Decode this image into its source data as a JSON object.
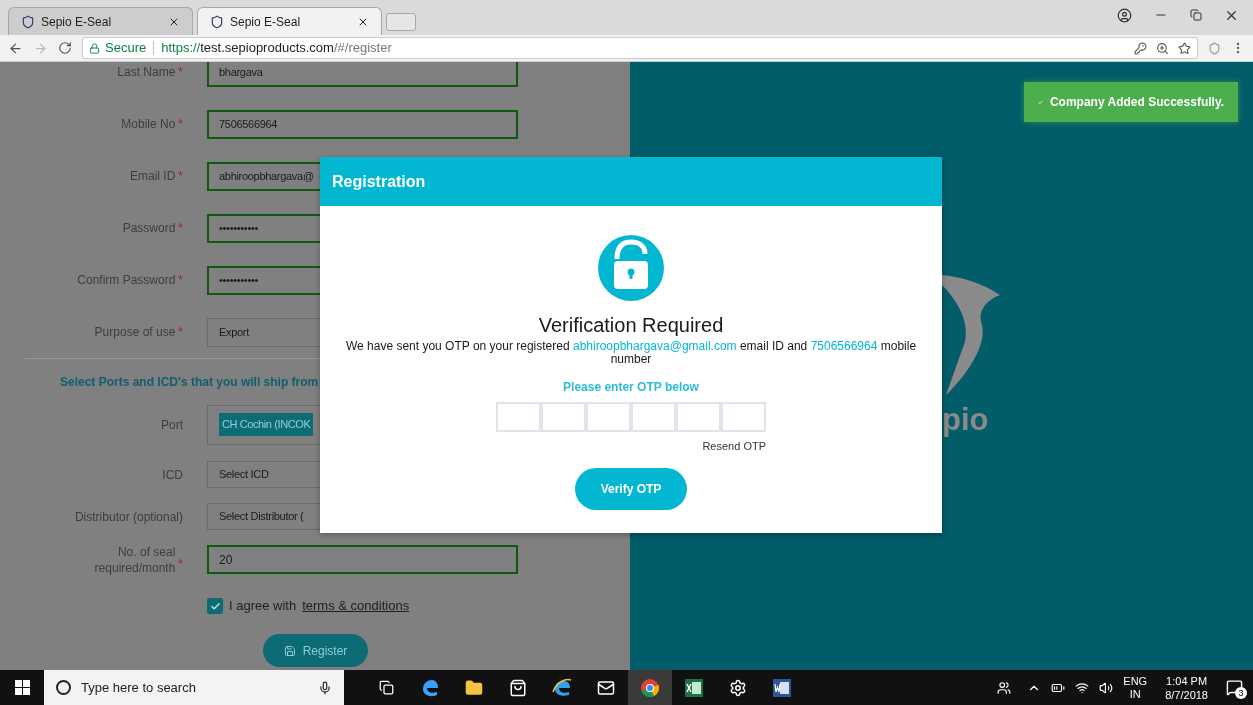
{
  "browser": {
    "tabs": [
      {
        "title": "Sepio E-Seal",
        "selected": false
      },
      {
        "title": "Sepio E-Seal",
        "selected": true
      }
    ],
    "security": "Secure",
    "url": {
      "scheme": "https://",
      "host": "test.sepioproducts.com",
      "path": "/#/register"
    }
  },
  "form": {
    "fields": [
      {
        "label": "Last Name",
        "required": true,
        "kind": "text",
        "value": "bhargava"
      },
      {
        "label": "Mobile No",
        "required": true,
        "kind": "text",
        "value": "7506566964"
      },
      {
        "label": "Email ID",
        "required": true,
        "kind": "text",
        "value": "abhiroopbhargava@"
      },
      {
        "label": "Password",
        "required": true,
        "kind": "text",
        "value": "•••••••••••"
      },
      {
        "label": "Confirm Password",
        "required": true,
        "kind": "text",
        "value": "•••••••••••"
      },
      {
        "label": "Purpose of use",
        "required": true,
        "kind": "select",
        "value": "Export"
      }
    ],
    "section_heading": "Select Ports and ICD's that you will ship from",
    "port_fields": [
      {
        "label": "Port",
        "required": false,
        "kind": "tags",
        "value": "CH Cochin (INCOK"
      },
      {
        "label": "ICD",
        "required": false,
        "kind": "select",
        "placeholder": "Select ICD"
      },
      {
        "label": "Distributor (optional)",
        "required": false,
        "kind": "select",
        "placeholder": "Select Distributor ("
      }
    ],
    "seal_field": {
      "label_lines": [
        "No. of seal",
        "required/month"
      ],
      "required": true,
      "value": "20"
    },
    "agree": {
      "checked": true,
      "text": "I agree with",
      "link": "terms & conditions"
    },
    "register_button": "Register",
    "required_mark": "*"
  },
  "brand_text": "pio",
  "toast": "Company Added Successfully.",
  "modal": {
    "title": "Registration",
    "heading": "Verification Required",
    "message": {
      "before": "We have sent you OTP on your registered",
      "email": "abhiroopbhargava@gmail.com",
      "middle": "email ID and",
      "mobile": "7506566964",
      "after": "mobile number"
    },
    "otp_label": "Please enter OTP below",
    "resend": "Resend OTP",
    "verify_button": "Verify OTP"
  },
  "taskbar": {
    "search_placeholder": "Type here to search",
    "language": [
      "ENG",
      "IN"
    ],
    "time": "1:04 PM",
    "date": "8/7/2018",
    "notifications": "3"
  }
}
